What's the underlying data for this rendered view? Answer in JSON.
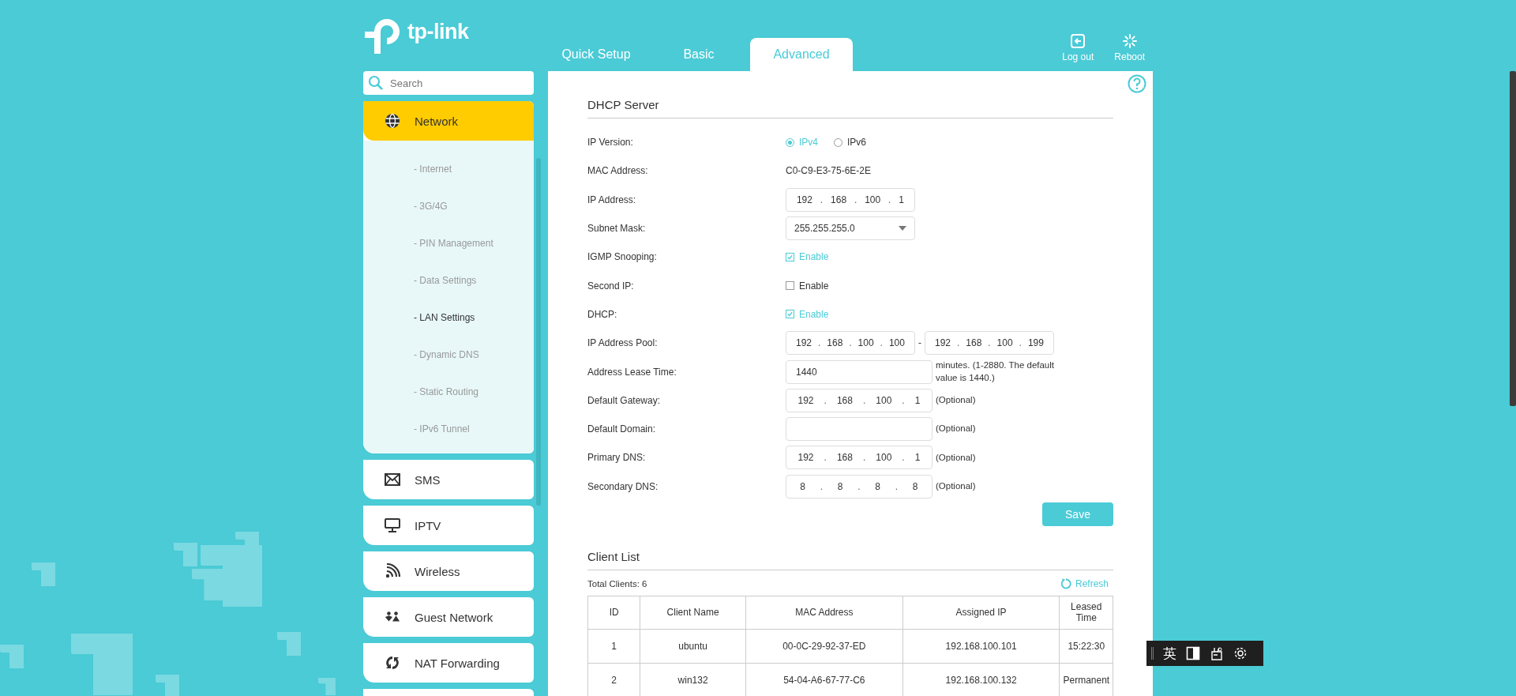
{
  "header": {
    "logo": "tp-link",
    "tabs": [
      {
        "label": "Quick Setup",
        "selected": false
      },
      {
        "label": "Basic",
        "selected": false
      },
      {
        "label": "Advanced",
        "selected": true
      }
    ],
    "actions": [
      {
        "label": "Log out",
        "kind": "logout"
      },
      {
        "label": "Reboot",
        "kind": "reboot"
      }
    ]
  },
  "sidebar": {
    "search": {
      "placeholder": "Search"
    },
    "items": [
      {
        "label": "Network",
        "kind": "globe",
        "expanded": true,
        "children": [
          {
            "label": "- Internet",
            "selected": false
          },
          {
            "label": "- 3G/4G",
            "selected": false
          },
          {
            "label": "- PIN Management",
            "selected": false
          },
          {
            "label": "- Data Settings",
            "selected": false
          },
          {
            "label": "- LAN Settings",
            "selected": true
          },
          {
            "label": "- Dynamic DNS",
            "selected": false
          },
          {
            "label": "- Static Routing",
            "selected": false
          },
          {
            "label": "- IPv6 Tunnel",
            "selected": false
          }
        ]
      },
      {
        "label": "SMS",
        "kind": "mail",
        "expanded": false
      },
      {
        "label": "IPTV",
        "kind": "monitor",
        "expanded": false
      },
      {
        "label": "Wireless",
        "kind": "signal",
        "expanded": false
      },
      {
        "label": "Guest Network",
        "kind": "people",
        "expanded": false
      },
      {
        "label": "NAT Forwarding",
        "kind": "cycle",
        "expanded": false
      }
    ]
  },
  "dhcp_server": {
    "title": "DHCP Server",
    "fields": [
      {
        "label": "IP Version:",
        "kind": "radio",
        "options": [
          {
            "label": "IPv4",
            "selected": true
          },
          {
            "label": "IPv6",
            "selected": false
          }
        ]
      },
      {
        "label": "MAC Address:",
        "kind": "text",
        "value": "C0-C9-E3-75-6E-2E"
      },
      {
        "label": "IP Address:",
        "kind": "ip",
        "value": "192 . 168 . 100 . 1"
      },
      {
        "label": "Subnet Mask:",
        "kind": "select",
        "value": "255.255.255.0"
      },
      {
        "label": "IGMP Snooping:",
        "kind": "checkbox",
        "option": "Enable",
        "checked": true
      },
      {
        "label": "Second IP:",
        "kind": "checkbox",
        "option": "Enable",
        "checked": false
      },
      {
        "label": "DHCP:",
        "kind": "checkbox",
        "option": "Enable",
        "checked": true
      },
      {
        "label": "IP Address Pool:",
        "kind": "ip_range",
        "from": "192 . 168 . 100 . 100",
        "separator": "-",
        "to": "192 . 168 . 100 . 199"
      },
      {
        "label": "Address Lease Time:",
        "kind": "input",
        "value": "1440",
        "note": "minutes. (1-2880. The default value is 1440.)"
      },
      {
        "label": "Default Gateway:",
        "kind": "ip",
        "value": "192 . 168 . 100 . 1",
        "note": "(Optional)"
      },
      {
        "label": "Default Domain:",
        "kind": "input",
        "note": "(Optional)"
      },
      {
        "label": "Primary DNS:",
        "kind": "ip",
        "value": "192 . 168 . 100 . 1",
        "note": "(Optional)"
      },
      {
        "label": "Secondary DNS:",
        "kind": "ip",
        "value": "8 . 8 . 8 . 8",
        "note": "(Optional)"
      }
    ],
    "save_button": "Save"
  },
  "client_list": {
    "title": "Client List",
    "total": "Total Clients: 6",
    "refresh": "Refresh",
    "columns": [
      "ID",
      "Client Name",
      "MAC Address",
      "Assigned IP",
      "Leased Time"
    ],
    "rows": [
      [
        "1",
        "ubuntu",
        "00-0C-29-92-37-ED",
        "192.168.100.101",
        "15:22:30"
      ],
      [
        "2",
        "win132",
        "54-04-A6-67-77-C6",
        "192.168.100.132",
        "Permanent"
      ]
    ]
  },
  "ime_toolbar": {
    "language": "英"
  }
}
